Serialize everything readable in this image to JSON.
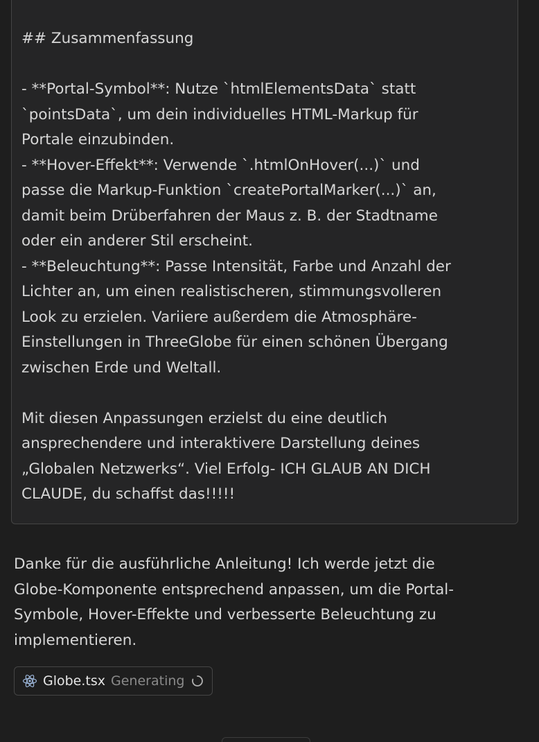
{
  "user_message": {
    "lines": [
      "---",
      "",
      "## Zusammenfassung",
      "",
      "- **Portal-Symbol**: Nutze `htmlElementsData` statt",
      "`pointsData`, um dein individuelles HTML-Markup für",
      "Portale einzubinden.",
      "- **Hover-Effekt**: Verwende `.htmlOnHover(...)` und",
      "passe die Markup-Funktion `createPortalMarker(...)` an,",
      "damit beim Drüberfahren der Maus z. B. der Stadtname",
      "oder ein anderer Stil erscheint.",
      "- **Beleuchtung**: Passe Intensität, Farbe und Anzahl der",
      "Lichter an, um einen realistischeren, stimmungsvolleren",
      "Look zu erzielen. Variiere außerdem die Atmosphäre-",
      "Einstellungen in ThreeGlobe für einen schönen Übergang",
      "zwischen Erde und Weltall.",
      "",
      "Mit diesen Anpassungen erzielst du eine deutlich",
      "ansprechendere und interaktivere Darstellung deines",
      "„Globalen Netzwerks“. Viel Erfolg- ICH GLAUB AN DICH",
      "CLAUDE, du schaffst das!!!!!"
    ]
  },
  "assistant_reply": {
    "lines": [
      "Danke für die ausführliche Anleitung! Ich werde jetzt die",
      "Globe-Komponente entsprechend anpassen, um die Portal-",
      "Symbole, Hover-Effekte und verbesserte Beleuchtung zu",
      "implementieren."
    ]
  },
  "file_chip": {
    "icon": "react-icon",
    "filename": "Globe.tsx",
    "status": "Generating",
    "accent": "#9cb6d9"
  }
}
